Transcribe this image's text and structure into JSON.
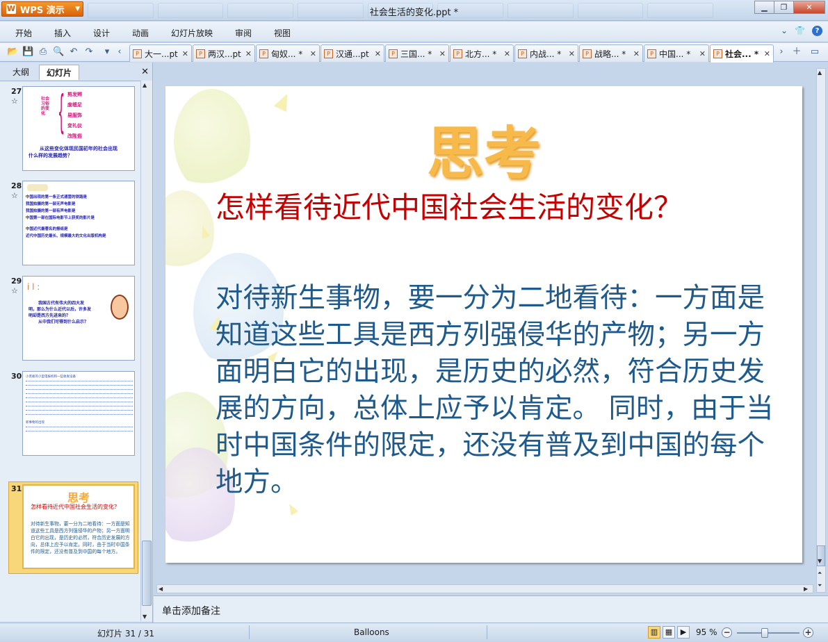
{
  "window": {
    "app_button": "WPS 演示",
    "title": "社会生活的变化.ppt *"
  },
  "menu": [
    "开始",
    "插入",
    "设计",
    "动画",
    "幻灯片放映",
    "审阅",
    "视图"
  ],
  "doc_tabs": [
    {
      "label": "大一...pt",
      "active": false
    },
    {
      "label": "两汉...pt",
      "active": false
    },
    {
      "label": "匈奴... *",
      "active": false
    },
    {
      "label": "汉通...pt",
      "active": false
    },
    {
      "label": "三国... *",
      "active": false
    },
    {
      "label": "北方... *",
      "active": false
    },
    {
      "label": "内战... *",
      "active": false
    },
    {
      "label": "战略... *",
      "active": false
    },
    {
      "label": "中国... *",
      "active": false
    },
    {
      "label": "社会... *",
      "active": true
    }
  ],
  "left_panel": {
    "tabs": [
      "大纲",
      "幻灯片"
    ],
    "active_tab": "幻灯片",
    "thumbnails": [
      {
        "num": "27",
        "lines": [
          "从这些变化体现民国初年的社会出现",
          "什么样的发展趋势？"
        ],
        "brace_items": [
          "剪发辫",
          "废缠足",
          "易服饰",
          "变礼仪",
          "改陈俗"
        ]
      },
      {
        "num": "28",
        "lines": [
          "中国出现的第一条正式通营的铁路是",
          "我国拍摄的第一部无声电影是",
          "我国拍摄的第一部有声电影是",
          "中国第一部在国际电影节上获奖的影片是",
          "中国近代最著名的报纸是",
          "近代中国历史最长、规模最大的文化出版机构是"
        ]
      },
      {
        "num": "29",
        "lines": [
          "我国古代有伟大的四大发",
          "明，那么为什么近代以后，许多发",
          "明却是西方先进来的？",
          "从中我们可得到什么启示？"
        ]
      },
      {
        "num": "30",
        "lines": [
          "小黑板的小型电报机和一些收发设备",
          "新事物的出现"
        ]
      },
      {
        "num": "31",
        "title": "思考",
        "sub": "怎样看待近代中国社会生活的变化？",
        "body": "对待新生事物，要一分为二地看待：一方面是知道这些工具是西方列强侵华的产物；另一方面明白它的出现，是历史的必然，符合历史发展的方向，总体上应予以肯定。同时，由于当时中国条件的限定，还没有普及到中国的每个地方。"
      }
    ]
  },
  "slide": {
    "title": "思考",
    "subtitle": "怎样看待近代中国社会生活的变化？",
    "body": "对待新生事物，要一分为二地看待：一方面是知道这些工具是西方列强侵华的产物；另一方面明白它的出现，是历史的必然，符合历史发展的方向，总体上应予以肯定。 同时，由于当时中国条件的限定，还没有普及到中国的每个地方。"
  },
  "notes_placeholder": "单击添加备注",
  "status": {
    "slide_counter": "幻灯片 31 / 31",
    "theme": "Balloons",
    "zoom": "95 %"
  }
}
